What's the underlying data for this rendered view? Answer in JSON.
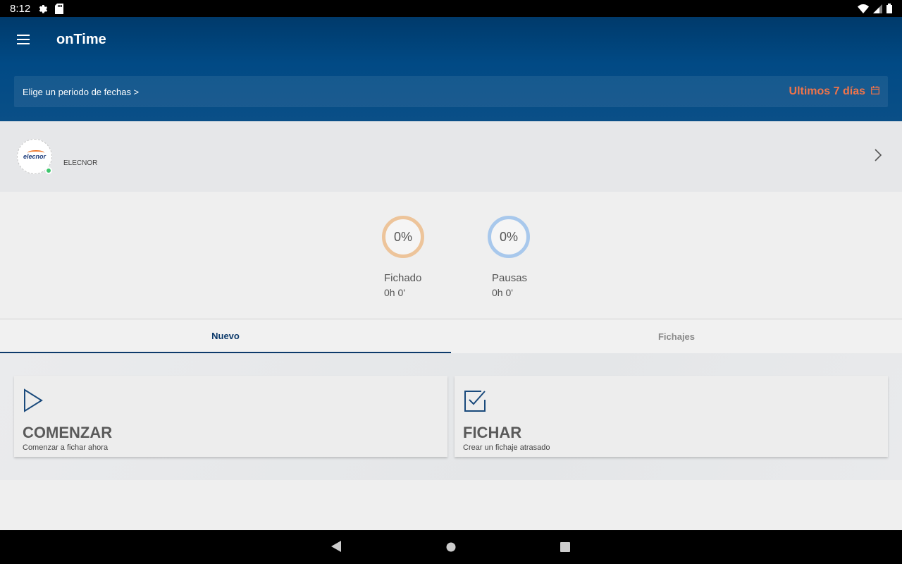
{
  "status_bar": {
    "time": "8:12",
    "icons_left": [
      "gear-icon",
      "sd-card-icon"
    ],
    "icons_right": [
      "wifi-icon",
      "signal-icon",
      "battery-icon"
    ]
  },
  "header": {
    "title": "onTime",
    "menu_icon": "hamburger-menu-icon",
    "background_color": "#014a85"
  },
  "date_selector": {
    "prompt": "Elige un periodo de fechas >",
    "range": "Ultimos 7 días",
    "range_color": "#f0744a",
    "icon": "calendar-icon"
  },
  "company": {
    "logo_text": "elecnor",
    "name": "ELECNOR",
    "status_color": "#3ec66d",
    "icon": "chevron-right-icon"
  },
  "stats": [
    {
      "percent": "0%",
      "label": "Fichado",
      "duration": "0h 0'",
      "ring_color": "#edc49a"
    },
    {
      "percent": "0%",
      "label": "Pausas",
      "duration": "0h 0'",
      "ring_color": "#a8c8ec"
    }
  ],
  "tabs": [
    {
      "label": "Nuevo",
      "active": true
    },
    {
      "label": "Fichajes",
      "active": false
    }
  ],
  "actions": [
    {
      "title": "COMENZAR",
      "subtitle": "Comenzar a fichar ahora",
      "icon": "play-icon"
    },
    {
      "title": "FICHAR",
      "subtitle": "Crear un fichaje atrasado",
      "icon": "checkbox-icon"
    }
  ],
  "nav_bar": {
    "icons": [
      "back-icon",
      "home-icon",
      "recent-apps-icon"
    ]
  }
}
